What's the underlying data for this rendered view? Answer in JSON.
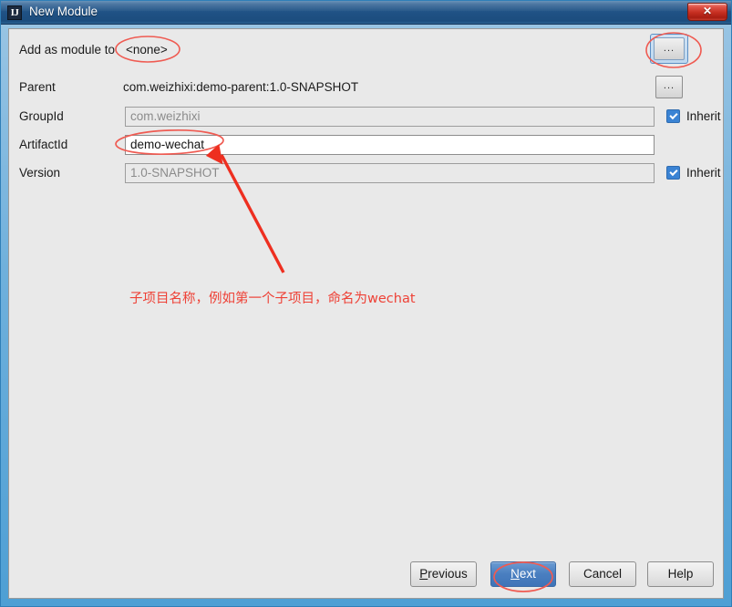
{
  "window": {
    "title": "New Module",
    "app_icon": "IJ",
    "app_icon_name": "intellij-idea-icon",
    "close_glyph": "✕",
    "titlebar_color": "#1f5184",
    "body_color": "#e9e9e9",
    "frame_color": "#4e9fd4"
  },
  "form": {
    "add_as_module_to": {
      "label": "Add as module to",
      "value": "<none>"
    },
    "parent": {
      "label": "Parent",
      "value": "com.weizhixi:demo-parent:1.0-SNAPSHOT"
    },
    "group_id": {
      "label": "GroupId",
      "value": "com.weizhixi",
      "enabled": false,
      "inherit_label": "Inherit",
      "inherit_checked": true
    },
    "artifact_id": {
      "label": "ArtifactId",
      "value": "demo-wechat",
      "enabled": true
    },
    "version": {
      "label": "Version",
      "value": "1.0-SNAPSHOT",
      "enabled": false,
      "inherit_label": "Inherit",
      "inherit_checked": true
    },
    "browse_button_label": "...",
    "browse_button_parent_label": "..."
  },
  "annotation": {
    "text": "子项目名称，例如第一个子项目，命名为wechat",
    "color": "#ee4136"
  },
  "buttons": {
    "previous": "Previous",
    "previous_mnemonic": "P",
    "next": "Next",
    "next_mnemonic": "N",
    "cancel": "Cancel",
    "help": "Help",
    "default_button": "Next",
    "default_button_color": "#4a7fc0"
  }
}
